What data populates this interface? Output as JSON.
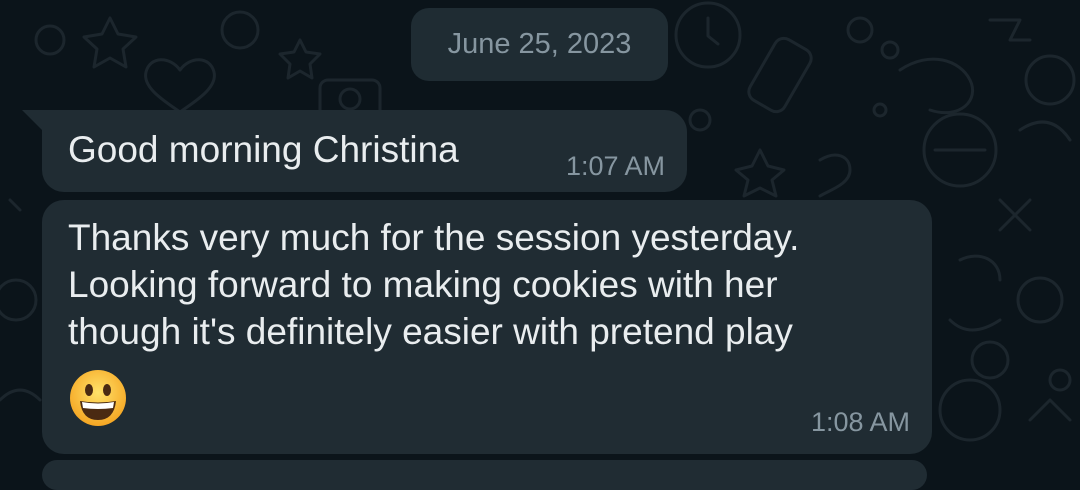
{
  "chat": {
    "date_divider": "June 25, 2023",
    "messages": [
      {
        "lines": [
          "Good morning Christina"
        ],
        "time": "1:07 AM"
      },
      {
        "lines": [
          "Thanks very much for the session yesterday.",
          "Looking forward to making cookies with her",
          "though it's definitely easier with pretend play"
        ],
        "emoji": "grinning-face-emoji",
        "time": "1:08 AM"
      }
    ]
  },
  "theme": {
    "background": "#0b141a",
    "bubble": "#202c33",
    "date_chip": "#1f2c33",
    "text": "#e9edef",
    "meta_text": "#8696a0"
  }
}
